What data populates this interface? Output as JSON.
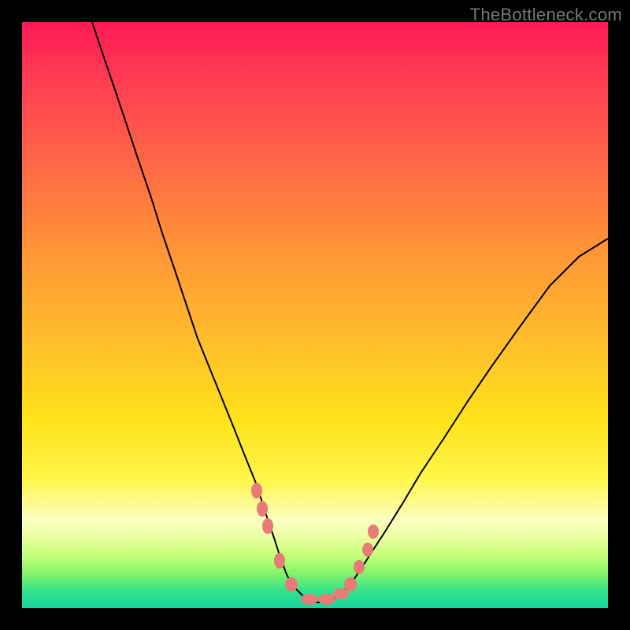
{
  "watermark": "TheBottleneck.com",
  "chart_data": {
    "type": "line",
    "title": "",
    "xlabel": "",
    "ylabel": "",
    "xlim": [
      0,
      100
    ],
    "ylim": [
      0,
      100
    ],
    "grid": false,
    "series": [
      {
        "name": "curve",
        "x": [
          12,
          14,
          16,
          18,
          20,
          22,
          24,
          26,
          28,
          30,
          32,
          34,
          36,
          38,
          40,
          41,
          42,
          43,
          44,
          45,
          46,
          48,
          50,
          52,
          54,
          56,
          58,
          60,
          62,
          65,
          68,
          72,
          76,
          80,
          85,
          90,
          95,
          100
        ],
        "values": [
          100,
          94,
          88,
          82,
          76,
          70,
          64,
          58,
          52,
          46,
          41,
          36,
          31,
          26,
          21,
          18,
          15,
          12,
          9,
          6,
          4,
          2,
          1,
          1,
          2,
          4,
          7,
          10,
          13,
          18,
          23,
          29,
          35,
          41,
          48,
          55,
          60,
          63
        ]
      }
    ],
    "markers": {
      "approx_points": [
        {
          "x": 40,
          "y": 20
        },
        {
          "x": 41,
          "y": 17
        },
        {
          "x": 42,
          "y": 14
        },
        {
          "x": 44,
          "y": 8
        },
        {
          "x": 46,
          "y": 4
        },
        {
          "x": 49,
          "y": 1.5
        },
        {
          "x": 52,
          "y": 1.5
        },
        {
          "x": 54,
          "y": 2.5
        },
        {
          "x": 56,
          "y": 4
        },
        {
          "x": 57.5,
          "y": 7
        },
        {
          "x": 59,
          "y": 10
        },
        {
          "x": 60,
          "y": 13
        }
      ],
      "color": "#e87a77"
    },
    "background_gradient": {
      "top_color": "#ff1a55",
      "mid_color": "#ffd724",
      "bottom_color": "#14d89f"
    }
  }
}
